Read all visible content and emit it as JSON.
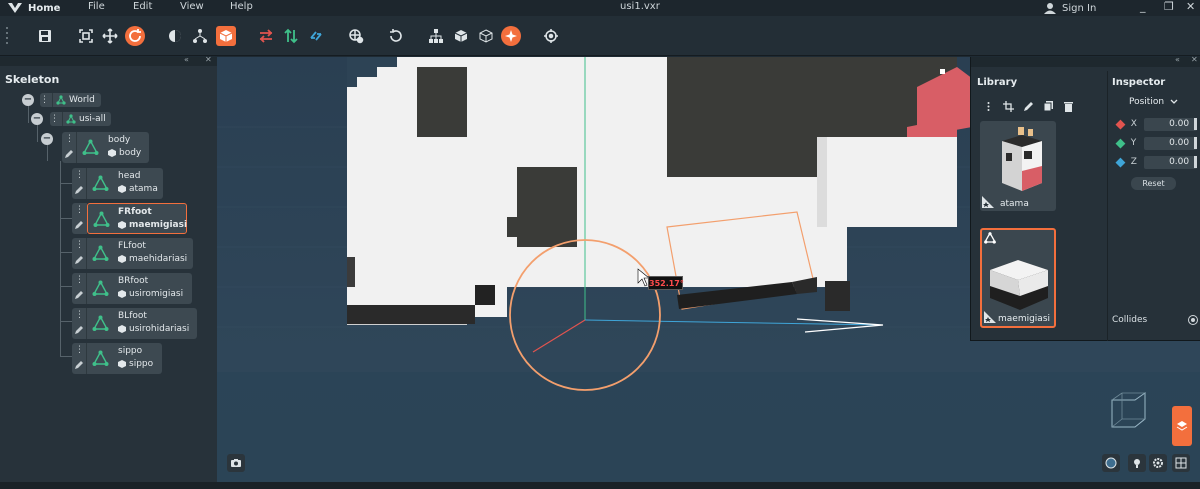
{
  "app": {
    "home_label": "Home",
    "menus": [
      "File",
      "Edit",
      "View",
      "Help"
    ],
    "file_title": "usi1.vxr",
    "signin_label": "Sign In",
    "window_controls": [
      "_",
      "❐",
      "✕"
    ]
  },
  "toolbar": {
    "icons": [
      "save-icon",
      "fit-view-icon",
      "move-icon",
      "rotate-icon",
      "pose-icon",
      "hierarchy-icon",
      "box-icon",
      "swap-icon",
      "mirror-icon",
      "flip-icon",
      "camera-icon",
      "reset-rotation-icon",
      "tree-icon",
      "cube-solid-icon",
      "cube-wire-icon",
      "add-icon",
      "target-icon"
    ],
    "active_tool": "rotate-icon",
    "accent_color": "#f36f3d"
  },
  "skeleton": {
    "title": "Skeleton",
    "header_controls": [
      "«",
      "✕"
    ],
    "root": {
      "label": "World"
    },
    "group": {
      "label": "usi-all"
    },
    "bones": [
      {
        "name": "body",
        "model": "body",
        "selected": false
      },
      {
        "name": "head",
        "model": "atama",
        "selected": false
      },
      {
        "name": "FRfoot",
        "model": "maemigiasi",
        "selected": true
      },
      {
        "name": "FLfoot",
        "model": "maehidariasi",
        "selected": false
      },
      {
        "name": "BRfoot",
        "model": "usiromigiasi",
        "selected": false
      },
      {
        "name": "BLfoot",
        "model": "usirohidariasi",
        "selected": false
      },
      {
        "name": "sippo",
        "model": "sippo",
        "selected": false
      }
    ]
  },
  "viewport": {
    "rotation_angle": "352.17°",
    "background_color": "#2d4355"
  },
  "library": {
    "title": "Library",
    "header_controls": [
      "«",
      "✕"
    ],
    "items": [
      {
        "label": "atama",
        "selected": false
      },
      {
        "label": "maemigiasi",
        "selected": true
      }
    ]
  },
  "inspector": {
    "title": "Inspector",
    "section": "Position",
    "axes": [
      {
        "axis": "X",
        "value": "0.00",
        "color": "#e2544f"
      },
      {
        "axis": "Y",
        "value": "0.00",
        "color": "#3fc08a"
      },
      {
        "axis": "Z",
        "value": "0.00",
        "color": "#3fa5d8"
      }
    ],
    "reset_label": "Reset",
    "collides_label": "Collides"
  }
}
